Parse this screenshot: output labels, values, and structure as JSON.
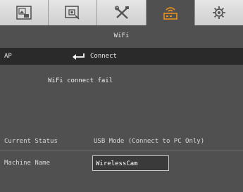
{
  "tabs": [
    {
      "icon": "picture-in-picture-icon",
      "active": false
    },
    {
      "icon": "camera-settings-icon",
      "active": false
    },
    {
      "icon": "tools-icon",
      "active": false
    },
    {
      "icon": "wifi-icon",
      "active": true
    },
    {
      "icon": "gear-icon",
      "active": false
    }
  ],
  "colors": {
    "accent": "#e89020",
    "background": "#505050",
    "row_highlight": "#2a2a2a"
  },
  "page": {
    "title": "WiFi"
  },
  "ap": {
    "label": "AP",
    "connect_icon": "enter-arrow-icon",
    "connect_label": "Connect"
  },
  "message": "WiFi connect fail",
  "status": {
    "label": "Current Status",
    "value": "USB Mode (Connect to PC Only)"
  },
  "machine": {
    "label": "Machine Name",
    "value": "WirelessCam"
  }
}
